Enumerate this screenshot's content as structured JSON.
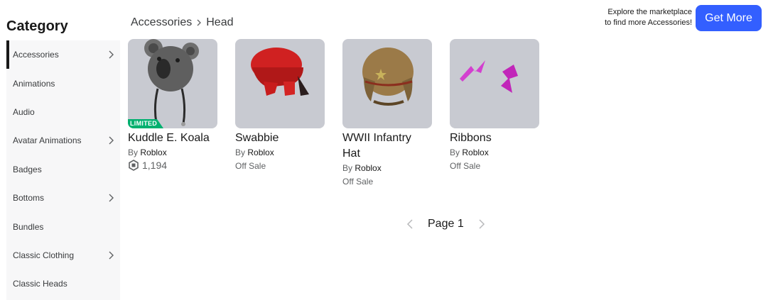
{
  "sidebar": {
    "title": "Category",
    "items": [
      {
        "label": "Accessories",
        "has_chevron": true,
        "active": true
      },
      {
        "label": "Animations",
        "has_chevron": false
      },
      {
        "label": "Audio",
        "has_chevron": false
      },
      {
        "label": "Avatar Animations",
        "has_chevron": true
      },
      {
        "label": "Badges",
        "has_chevron": false
      },
      {
        "label": "Bottoms",
        "has_chevron": true
      },
      {
        "label": "Bundles",
        "has_chevron": false
      },
      {
        "label": "Classic Clothing",
        "has_chevron": true
      },
      {
        "label": "Classic Heads",
        "has_chevron": false
      }
    ]
  },
  "breadcrumb": {
    "root": "Accessories",
    "current": "Head"
  },
  "promo": {
    "line1": "Explore the marketplace",
    "line2": "to find more Accessories!",
    "button_label": "Get More"
  },
  "items": [
    {
      "name": "Kuddle E. Koala",
      "by_prefix": "By",
      "creator": "Roblox",
      "price": "1,194",
      "badge": "LIMITED",
      "price_icon": "robux-icon"
    },
    {
      "name": "Swabbie",
      "by_prefix": "By",
      "creator": "Roblox",
      "price": "Off Sale"
    },
    {
      "name": "WWII Infantry Hat",
      "by_prefix": "By",
      "creator": "Roblox",
      "price": "Off Sale"
    },
    {
      "name": "Ribbons",
      "by_prefix": "By",
      "creator": "Roblox",
      "price": "Off Sale"
    }
  ],
  "pagination": {
    "label": "Page 1"
  },
  "colors": {
    "accent": "#335fff",
    "limited_badge": "#00b06f",
    "thumb_bg": "#c8cad1"
  }
}
